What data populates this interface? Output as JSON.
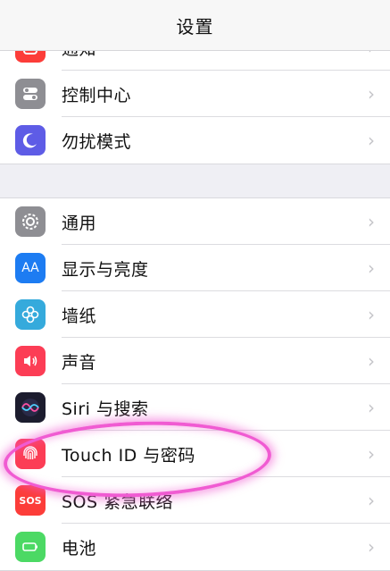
{
  "nav": {
    "title": "设置"
  },
  "group_top": [
    {
      "label": "通知",
      "icon": "notifications-icon",
      "color": "#fc3d39"
    },
    {
      "label": "控制中心",
      "icon": "control-center-icon",
      "color": "#8e8e93"
    },
    {
      "label": "勿扰模式",
      "icon": "moon-icon",
      "color": "#5e5ce6"
    }
  ],
  "group_general": [
    {
      "label": "通用",
      "icon": "gear-icon",
      "color": "#8e8e93"
    },
    {
      "label": "显示与亮度",
      "icon": "display-icon",
      "icon_text": "AA",
      "color": "#1d7cf2"
    },
    {
      "label": "墙纸",
      "icon": "wallpaper-icon",
      "color": "#35aadc"
    },
    {
      "label": "声音",
      "icon": "speaker-icon",
      "color": "#fc3d55"
    },
    {
      "label": "Siri 与搜索",
      "icon": "siri-icon",
      "color": "#1c1c2e"
    },
    {
      "label": "Touch ID 与密码",
      "icon": "fingerprint-icon",
      "color": "#fc3d55"
    },
    {
      "label": "SOS 紧急联络",
      "icon": "sos-icon",
      "icon_text": "SOS",
      "color": "#fc3d39"
    },
    {
      "label": "电池",
      "icon": "battery-icon",
      "color": "#4cd964"
    }
  ],
  "highlight_color": "#f05bd2"
}
